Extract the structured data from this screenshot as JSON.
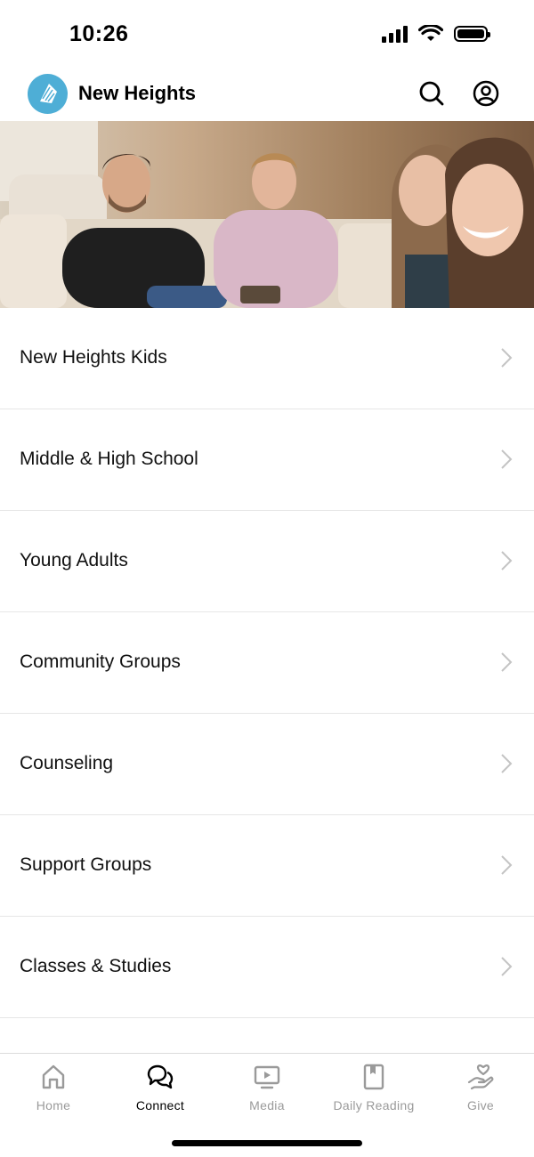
{
  "status_bar": {
    "time": "10:26"
  },
  "header": {
    "title": "New Heights",
    "logo_color": "#4eaed6",
    "search_icon": "search-icon",
    "profile_icon": "user-circle-icon"
  },
  "hero": {
    "image": "people-sitting-on-couch-smiling"
  },
  "menu": {
    "items": [
      {
        "label": "New Heights Kids"
      },
      {
        "label": "Middle & High School"
      },
      {
        "label": "Young Adults"
      },
      {
        "label": "Community Groups"
      },
      {
        "label": "Counseling"
      },
      {
        "label": "Support Groups"
      },
      {
        "label": "Classes & Studies"
      }
    ]
  },
  "tabs": {
    "items": [
      {
        "label": "Home",
        "icon": "home-icon",
        "active": false
      },
      {
        "label": "Connect",
        "icon": "chat-bubbles-icon",
        "active": true
      },
      {
        "label": "Media",
        "icon": "video-player-icon",
        "active": false
      },
      {
        "label": "Daily Reading",
        "icon": "bookmark-book-icon",
        "active": false
      },
      {
        "label": "Give",
        "icon": "heart-hand-icon",
        "active": false
      }
    ]
  }
}
